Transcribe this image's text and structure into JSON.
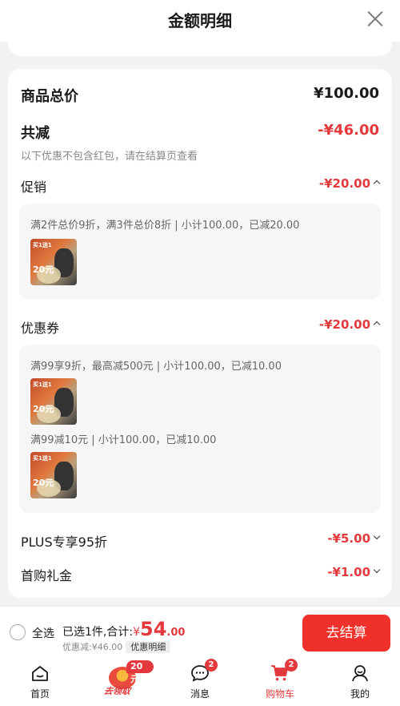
{
  "header": {
    "title": "金额明细"
  },
  "summary": {
    "total_label": "商品总价",
    "total_value": "¥100.00",
    "reduce_label": "共减",
    "reduce_value": "-¥46.00",
    "reduce_note": "以下优惠不包含红包，请在结算页查看"
  },
  "promotion": {
    "label": "促销",
    "value": "-¥20.00",
    "lines": [
      "满2件总价9折，满3件总价8折 | 小计100.00，已减20.00"
    ],
    "product_thumb_text": "买1送1",
    "product_thumb_price": "20元"
  },
  "coupon": {
    "label": "优惠券",
    "value": "-¥20.00",
    "lines": [
      "满99享9折，最高减500元 | 小计100.00，已减10.00",
      "满99减10元 | 小计100.00，已减10.00"
    ]
  },
  "plus": {
    "label": "PLUS专享95折",
    "value": "-¥5.00"
  },
  "first_gift": {
    "label": "首购礼金",
    "value": "-¥1.00"
  },
  "bottom_bar": {
    "select_all": "全选",
    "selected_text": "已选1件,合计:",
    "currency": "¥",
    "amount_int": "54",
    "amount_dec": ".00",
    "discount_text": "优惠减:¥46.00",
    "detail_tag": "优惠明细",
    "checkout": "去结算"
  },
  "tabbar": {
    "items": [
      {
        "label": "首页",
        "icon": "home-icon"
      },
      {
        "label": "消息",
        "icon": "message-icon",
        "badge": "2"
      },
      {
        "label": "购物车",
        "icon": "cart-icon",
        "badge": "2",
        "active": true
      },
      {
        "label": "我的",
        "icon": "profile-icon"
      }
    ],
    "promo": {
      "badge": "20元",
      "text": "去领取"
    }
  },
  "colors": {
    "accent": "#e4393c",
    "checkout_bg": "#f0312b"
  }
}
